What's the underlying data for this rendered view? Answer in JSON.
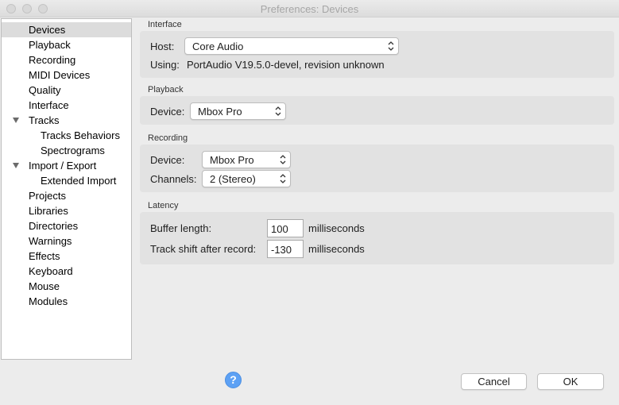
{
  "window": {
    "title": "Preferences: Devices"
  },
  "sidebar": {
    "items": [
      {
        "label": "Devices",
        "selected": true
      },
      {
        "label": "Playback"
      },
      {
        "label": "Recording"
      },
      {
        "label": "MIDI Devices"
      },
      {
        "label": "Quality"
      },
      {
        "label": "Interface"
      },
      {
        "label": "Tracks",
        "expanded": true
      },
      {
        "label": "Tracks Behaviors"
      },
      {
        "label": "Spectrograms"
      },
      {
        "label": "Import / Export",
        "expanded": true
      },
      {
        "label": "Extended Import"
      },
      {
        "label": "Projects"
      },
      {
        "label": "Libraries"
      },
      {
        "label": "Directories"
      },
      {
        "label": "Warnings"
      },
      {
        "label": "Effects"
      },
      {
        "label": "Keyboard"
      },
      {
        "label": "Mouse"
      },
      {
        "label": "Modules"
      }
    ]
  },
  "interface": {
    "title": "Interface",
    "host_label": "Host:",
    "host_value": "Core Audio",
    "using_label": "Using:",
    "using_value": "PortAudio V19.5.0-devel, revision unknown"
  },
  "playback": {
    "title": "Playback",
    "device_label": "Device:",
    "device_value": "Mbox Pro"
  },
  "recording": {
    "title": "Recording",
    "device_label": "Device:",
    "device_value": "Mbox Pro",
    "channels_label": "Channels:",
    "channels_value": "2 (Stereo)"
  },
  "latency": {
    "title": "Latency",
    "buffer_label": "Buffer length:",
    "buffer_value": "100",
    "buffer_unit": "milliseconds",
    "shift_label": "Track shift after record:",
    "shift_value": "-130",
    "shift_unit": "milliseconds"
  },
  "footer": {
    "help_glyph": "?",
    "cancel_label": "Cancel",
    "ok_label": "OK"
  }
}
